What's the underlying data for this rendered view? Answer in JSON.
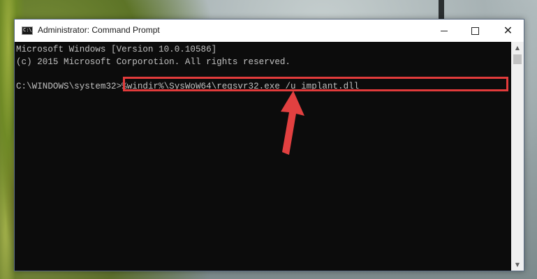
{
  "window": {
    "title": "Administrator: Command Prompt",
    "app_icon": "cmd-icon",
    "app_icon_text": "C:\\",
    "controls": {
      "minimize": "minimize-icon",
      "maximize": "maximize-icon",
      "close": "close-icon",
      "close_glyph": "✕"
    }
  },
  "console": {
    "lines": [
      "Microsoft Windows [Version 10.0.10586]",
      "(c) 2015 Microsoft Corporotion. All rights reserved."
    ],
    "prompt": "C:\\WINDOWS\\system32>",
    "command": "%windir%\\SysWoW64\\regsvr32.exe /u implant.dll"
  },
  "scrollbar": {
    "up_glyph": "▲",
    "down_glyph": "▼"
  },
  "colors": {
    "highlight_box": "#e23b3b",
    "arrow": "#e24040",
    "console_bg": "#0c0c0c",
    "console_text": "#c0c0c0"
  }
}
